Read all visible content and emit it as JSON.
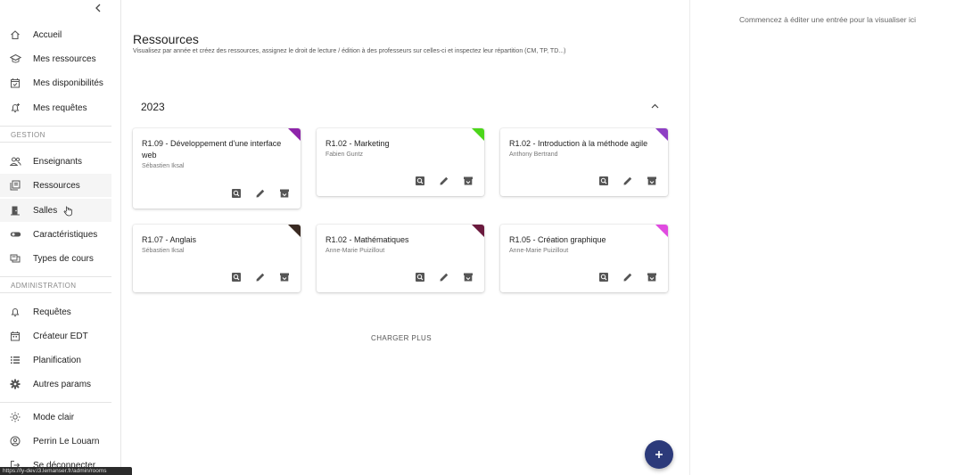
{
  "sidebar": {
    "items": [
      {
        "label": "Accueil",
        "icon": "home-icon"
      },
      {
        "label": "Mes ressources",
        "icon": "school-icon"
      },
      {
        "label": "Mes disponibilités",
        "icon": "calendar-check-icon"
      },
      {
        "label": "Mes requêtes",
        "icon": "notification-add-icon"
      }
    ],
    "gestion_title": "GESTION",
    "gestion_items": [
      {
        "label": "Enseignants",
        "icon": "people-icon"
      },
      {
        "label": "Ressources",
        "icon": "library-books-icon"
      },
      {
        "label": "Salles",
        "icon": "door-icon"
      },
      {
        "label": "Caractéristiques",
        "icon": "toggle-icon"
      },
      {
        "label": "Types de cours",
        "icon": "layers-icon"
      }
    ],
    "admin_title": "ADMINISTRATION",
    "admin_items": [
      {
        "label": "Requêtes",
        "icon": "bell-icon"
      },
      {
        "label": "Créateur EDT",
        "icon": "calendar-icon"
      },
      {
        "label": "Planification",
        "icon": "list-icon"
      },
      {
        "label": "Autres params",
        "icon": "gear-icon"
      }
    ],
    "theme_label": "Mode clair",
    "user_label": "Perrin Le Louarn",
    "logout_label": "Se déconnecter"
  },
  "main": {
    "title": "Ressources",
    "subtitle": "Visualisez par année et créez des ressources, assignez le droit de lecture / édition à des professeurs sur celles-ci et inspectez leur répartition (CM, TP, TD...)",
    "year": "2023",
    "cards": [
      {
        "title": "R1.09 - Développement d'une interface web",
        "teacher": "Sébastien Iksal",
        "color": "#8e24aa"
      },
      {
        "title": "R1.02 - Marketing",
        "teacher": "Fabien Guntz",
        "color": "#4cd61a"
      },
      {
        "title": "R1.02 - Introduction à la méthode agile",
        "teacher": "Anthony Bertrand",
        "color": "#8e3fc4"
      },
      {
        "title": "R1.07 - Anglais",
        "teacher": "Sébastien Iksal",
        "color": "#3a2a22"
      },
      {
        "title": "R1.02 - Mathématiques",
        "teacher": "Anne-Marie Puizillout",
        "color": "#6b1a3e"
      },
      {
        "title": "R1.05 - Création graphique",
        "teacher": "Anne-Marie Puizillout",
        "color": "#e04be0"
      }
    ],
    "load_more": "CHARGER PLUS"
  },
  "right_panel": {
    "message": "Commencez à éditer une entrée pour la visualiser ici"
  },
  "status_bar": {
    "url": "https://ly-dev.l3.lemanser.fr/admin/rooms"
  },
  "colors": {
    "fab": "#2c3a7a",
    "icon": "#5f6368"
  }
}
